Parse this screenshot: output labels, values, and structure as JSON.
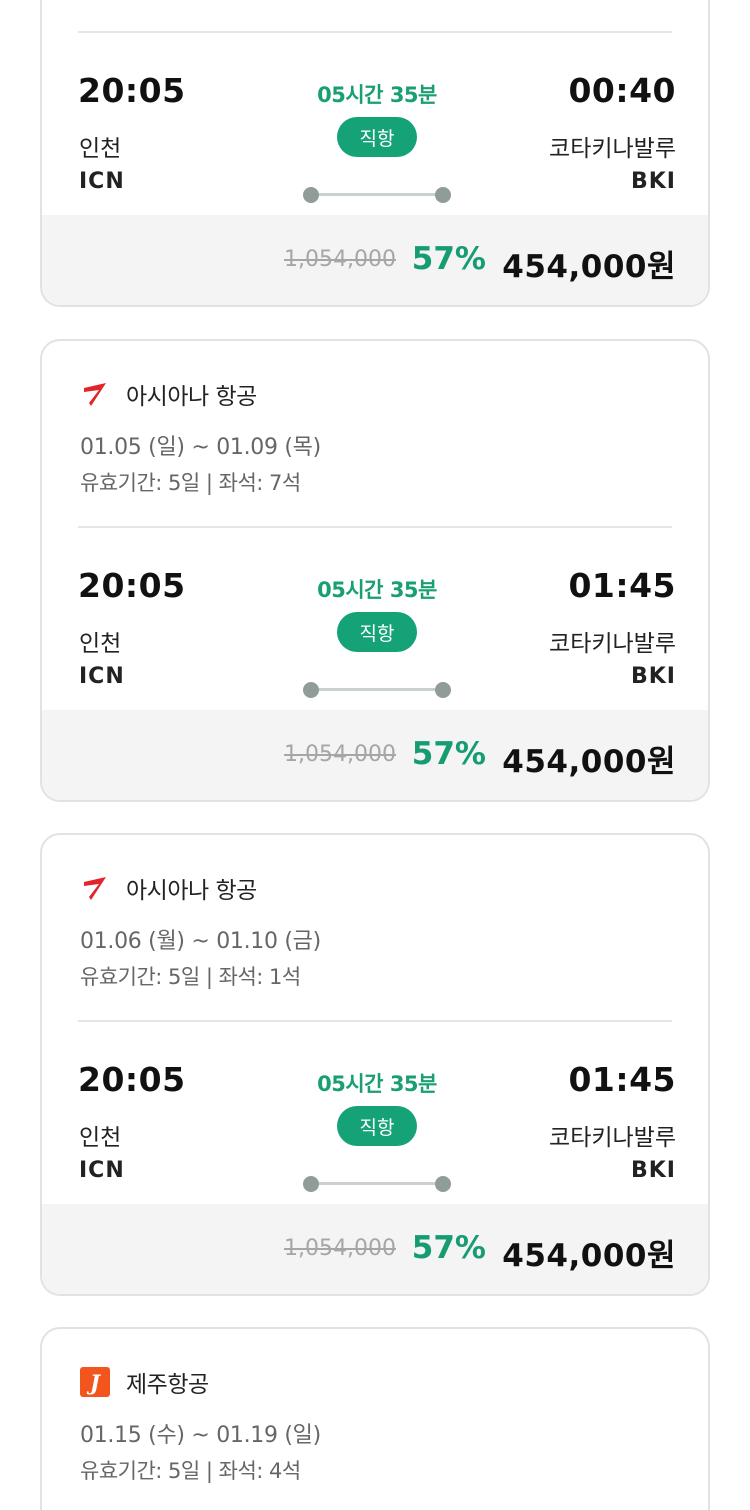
{
  "cards": [
    {
      "flight": {
        "dep_time": "20:05",
        "dep_city": "인천",
        "dep_code": "ICN",
        "duration": "05시간 35분",
        "type": "직항",
        "arr_time": "00:40",
        "arr_city": "코타키나발루",
        "arr_code": "BKI"
      },
      "price": {
        "original": "1,054,000",
        "discount": "57%",
        "final": "454,000원"
      }
    },
    {
      "airline": {
        "name": "아시아나 항공",
        "logo_icon": "asiana-logo-icon"
      },
      "dates": "01.05 (일) ~ 01.09 (목)",
      "validity": "유효기간: 5일 | 좌석: 7석",
      "flight": {
        "dep_time": "20:05",
        "dep_city": "인천",
        "dep_code": "ICN",
        "duration": "05시간 35분",
        "type": "직항",
        "arr_time": "01:45",
        "arr_city": "코타키나발루",
        "arr_code": "BKI"
      },
      "price": {
        "original": "1,054,000",
        "discount": "57%",
        "final": "454,000원"
      }
    },
    {
      "airline": {
        "name": "아시아나 항공",
        "logo_icon": "asiana-logo-icon"
      },
      "dates": "01.06 (월) ~ 01.10 (금)",
      "validity": "유효기간: 5일 | 좌석: 1석",
      "flight": {
        "dep_time": "20:05",
        "dep_city": "인천",
        "dep_code": "ICN",
        "duration": "05시간 35분",
        "type": "직항",
        "arr_time": "01:45",
        "arr_city": "코타키나발루",
        "arr_code": "BKI"
      },
      "price": {
        "original": "1,054,000",
        "discount": "57%",
        "final": "454,000원"
      }
    },
    {
      "airline": {
        "name": "제주항공",
        "logo_icon": "jejuair-logo-icon",
        "logo_letter": "J"
      },
      "dates": "01.15 (수) ~ 01.19 (일)",
      "validity": "유효기간: 5일 | 좌석: 4석"
    }
  ],
  "colors": {
    "accent": "#16a277",
    "discount": "#169c73",
    "asiana": "#e3242b",
    "jeju": "#f2561d"
  }
}
